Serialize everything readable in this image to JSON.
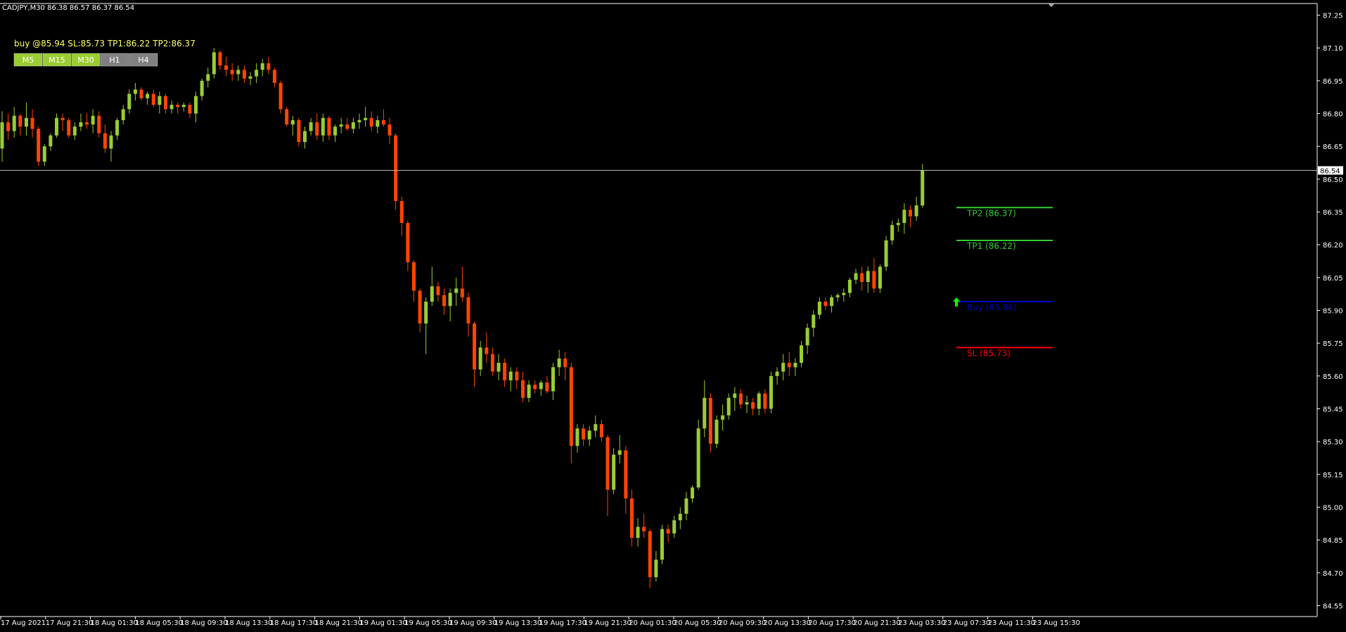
{
  "header": {
    "symbol_line": "CADJPY,M30  86.38 86.57 86.37 86.54"
  },
  "trade_info": {
    "text": "buy @85.94 SL:85.73 TP1:86.22 TP2:86.37"
  },
  "timeframe_buttons": [
    {
      "label": "M5",
      "active": true
    },
    {
      "label": "M15",
      "active": true
    },
    {
      "label": "M30",
      "active": true
    },
    {
      "label": "H1",
      "active": false
    },
    {
      "label": "H4",
      "active": false
    }
  ],
  "colors": {
    "up": "#9acd32",
    "down": "#ff4500",
    "bg": "#000000",
    "grid": "#ffffff",
    "tp": "#32cd32",
    "buy": "#0000cd",
    "sl": "#ff0000",
    "btn_active": "#9acd32",
    "btn_inactive": "#808080",
    "arrow": "#00ff00"
  },
  "chart_data": {
    "type": "candlestick",
    "symbol": "CADJPY",
    "timeframe": "M30",
    "ylim": [
      84.5,
      87.3
    ],
    "y_ticks": [
      "87.25",
      "87.10",
      "86.95",
      "86.80",
      "86.65",
      "86.50",
      "86.35",
      "86.20",
      "86.05",
      "85.90",
      "85.75",
      "85.60",
      "85.45",
      "85.30",
      "85.15",
      "85.00",
      "84.85",
      "84.70",
      "84.55"
    ],
    "current_price": "86.54",
    "x_labels": [
      "17 Aug 2021",
      "17 Aug 21:30",
      "18 Aug 01:30",
      "18 Aug 05:30",
      "18 Aug 09:30",
      "18 Aug 13:30",
      "18 Aug 17:30",
      "18 Aug 21:30",
      "19 Aug 01:30",
      "19 Aug 05:30",
      "19 Aug 09:30",
      "19 Aug 13:30",
      "19 Aug 17:30",
      "19 Aug 21:30",
      "20 Aug 01:30",
      "20 Aug 05:30",
      "20 Aug 09:30",
      "20 Aug 13:30",
      "20 Aug 17:30",
      "20 Aug 21:30",
      "23 Aug 03:30",
      "23 Aug 07:30",
      "23 Aug 11:30",
      "23 Aug 15:30"
    ],
    "candles": [
      [
        86.64,
        86.81,
        86.58,
        86.76
      ],
      [
        86.76,
        86.8,
        86.68,
        86.72
      ],
      [
        86.72,
        86.83,
        86.69,
        86.79
      ],
      [
        86.79,
        86.8,
        86.7,
        86.74
      ],
      [
        86.74,
        86.85,
        86.7,
        86.78
      ],
      [
        86.78,
        86.82,
        86.69,
        86.73
      ],
      [
        86.73,
        86.74,
        86.56,
        86.58
      ],
      [
        86.58,
        86.66,
        86.56,
        86.65
      ],
      [
        86.65,
        86.71,
        86.63,
        86.7
      ],
      [
        86.7,
        86.8,
        86.69,
        86.78
      ],
      [
        86.78,
        86.8,
        86.72,
        86.77
      ],
      [
        86.77,
        86.78,
        86.69,
        86.7
      ],
      [
        86.7,
        86.76,
        86.68,
        86.74
      ],
      [
        86.74,
        86.8,
        86.72,
        86.76
      ],
      [
        86.76,
        86.8,
        86.73,
        86.75
      ],
      [
        86.75,
        86.82,
        86.71,
        86.79
      ],
      [
        86.79,
        86.81,
        86.69,
        86.71
      ],
      [
        86.71,
        86.75,
        86.62,
        86.64
      ],
      [
        86.64,
        86.72,
        86.58,
        86.7
      ],
      [
        86.7,
        86.78,
        86.68,
        86.77
      ],
      [
        86.77,
        86.84,
        86.75,
        86.82
      ],
      [
        86.82,
        86.91,
        86.8,
        86.89
      ],
      [
        86.89,
        86.94,
        86.86,
        86.91
      ],
      [
        86.91,
        86.92,
        86.86,
        86.87
      ],
      [
        86.87,
        86.9,
        86.84,
        86.89
      ],
      [
        86.89,
        86.91,
        86.83,
        86.84
      ],
      [
        86.84,
        86.9,
        86.8,
        86.88
      ],
      [
        86.88,
        86.89,
        86.8,
        86.82
      ],
      [
        86.82,
        86.86,
        86.8,
        86.84
      ],
      [
        86.84,
        86.85,
        86.8,
        86.83
      ],
      [
        86.83,
        86.85,
        86.81,
        86.84
      ],
      [
        86.84,
        86.85,
        86.78,
        86.8
      ],
      [
        86.8,
        86.9,
        86.76,
        86.88
      ],
      [
        86.88,
        86.96,
        86.86,
        86.95
      ],
      [
        86.95,
        87.01,
        86.92,
        86.98
      ],
      [
        86.98,
        87.1,
        86.96,
        87.08
      ],
      [
        87.08,
        87.09,
        87.0,
        87.02
      ],
      [
        87.02,
        87.06,
        86.97,
        87.0
      ],
      [
        87.0,
        87.03,
        86.95,
        86.98
      ],
      [
        86.98,
        87.02,
        86.95,
        87.0
      ],
      [
        87.0,
        87.02,
        86.94,
        86.96
      ],
      [
        86.96,
        86.99,
        86.93,
        86.97
      ],
      [
        86.97,
        87.03,
        86.94,
        87.0
      ],
      [
        87.0,
        87.05,
        86.97,
        87.03
      ],
      [
        87.03,
        87.06,
        86.98,
        87.0
      ],
      [
        87.0,
        87.01,
        86.92,
        86.94
      ],
      [
        86.94,
        86.95,
        86.8,
        86.82
      ],
      [
        86.82,
        86.83,
        86.74,
        86.75
      ],
      [
        86.75,
        86.79,
        86.7,
        86.77
      ],
      [
        86.77,
        86.78,
        86.65,
        86.67
      ],
      [
        86.67,
        86.74,
        86.64,
        86.72
      ],
      [
        86.72,
        86.78,
        86.7,
        86.76
      ],
      [
        86.76,
        86.8,
        86.68,
        86.7
      ],
      [
        86.7,
        86.8,
        86.67,
        86.78
      ],
      [
        86.78,
        86.79,
        86.68,
        86.7
      ],
      [
        86.7,
        86.75,
        86.67,
        86.74
      ],
      [
        86.74,
        86.78,
        86.71,
        86.75
      ],
      [
        86.75,
        86.78,
        86.72,
        86.73
      ],
      [
        86.73,
        86.78,
        86.71,
        86.76
      ],
      [
        86.76,
        86.8,
        86.73,
        86.77
      ],
      [
        86.77,
        86.83,
        86.74,
        86.78
      ],
      [
        86.78,
        86.81,
        86.72,
        86.74
      ],
      [
        86.74,
        86.79,
        86.71,
        86.77
      ],
      [
        86.77,
        86.82,
        86.74,
        86.75
      ],
      [
        86.75,
        86.78,
        86.66,
        86.7
      ],
      [
        86.7,
        86.71,
        86.36,
        86.4
      ],
      [
        86.4,
        86.42,
        86.24,
        86.3
      ],
      [
        86.3,
        86.31,
        86.08,
        86.12
      ],
      [
        86.12,
        86.13,
        85.94,
        85.99
      ],
      [
        85.99,
        86.0,
        85.8,
        85.84
      ],
      [
        85.84,
        85.96,
        85.7,
        85.94
      ],
      [
        85.94,
        86.1,
        85.92,
        86.01
      ],
      [
        86.01,
        86.03,
        85.94,
        85.97
      ],
      [
        85.97,
        86.0,
        85.88,
        85.92
      ],
      [
        85.92,
        86.0,
        85.85,
        85.98
      ],
      [
        85.98,
        86.05,
        85.92,
        86.0
      ],
      [
        86.0,
        86.1,
        85.94,
        85.96
      ],
      [
        85.96,
        85.98,
        85.78,
        85.84
      ],
      [
        85.84,
        85.85,
        85.55,
        85.63
      ],
      [
        85.63,
        85.76,
        85.6,
        85.73
      ],
      [
        85.73,
        85.8,
        85.66,
        85.7
      ],
      [
        85.7,
        85.73,
        85.6,
        85.62
      ],
      [
        85.62,
        85.7,
        85.58,
        85.66
      ],
      [
        85.66,
        85.68,
        85.55,
        85.58
      ],
      [
        85.58,
        85.64,
        85.53,
        85.62
      ],
      [
        85.62,
        85.64,
        85.54,
        85.58
      ],
      [
        85.58,
        85.62,
        85.48,
        85.5
      ],
      [
        85.5,
        85.58,
        85.48,
        85.56
      ],
      [
        85.56,
        85.58,
        85.52,
        85.54
      ],
      [
        85.54,
        85.58,
        85.51,
        85.57
      ],
      [
        85.57,
        85.6,
        85.52,
        85.53
      ],
      [
        85.53,
        85.66,
        85.49,
        85.64
      ],
      [
        85.64,
        85.72,
        85.6,
        85.68
      ],
      [
        85.68,
        85.71,
        85.58,
        85.64
      ],
      [
        85.64,
        85.66,
        85.2,
        85.28
      ],
      [
        85.28,
        85.38,
        85.25,
        85.36
      ],
      [
        85.36,
        85.38,
        85.28,
        85.31
      ],
      [
        85.31,
        85.37,
        85.28,
        85.35
      ],
      [
        85.35,
        85.42,
        85.32,
        85.38
      ],
      [
        85.38,
        85.4,
        85.3,
        85.32
      ],
      [
        85.32,
        85.33,
        84.96,
        85.08
      ],
      [
        85.08,
        85.27,
        85.06,
        85.24
      ],
      [
        85.24,
        85.33,
        85.2,
        85.26
      ],
      [
        85.26,
        85.28,
        84.97,
        85.04
      ],
      [
        85.04,
        85.08,
        84.82,
        84.86
      ],
      [
        84.86,
        84.95,
        84.82,
        84.91
      ],
      [
        84.91,
        84.97,
        84.86,
        84.89
      ],
      [
        84.89,
        84.9,
        84.63,
        84.68
      ],
      [
        84.68,
        84.8,
        84.66,
        84.76
      ],
      [
        84.76,
        84.92,
        84.74,
        84.9
      ],
      [
        84.9,
        84.92,
        84.84,
        84.88
      ],
      [
        84.88,
        84.96,
        84.86,
        84.94
      ],
      [
        84.94,
        85.0,
        84.9,
        84.97
      ],
      [
        84.97,
        85.07,
        84.94,
        85.04
      ],
      [
        85.04,
        85.1,
        85.02,
        85.09
      ],
      [
        85.09,
        85.4,
        85.08,
        85.36
      ],
      [
        85.36,
        85.58,
        85.32,
        85.5
      ],
      [
        85.5,
        85.52,
        85.25,
        85.29
      ],
      [
        85.29,
        85.42,
        85.27,
        85.4
      ],
      [
        85.4,
        85.47,
        85.35,
        85.42
      ],
      [
        85.42,
        85.52,
        85.4,
        85.5
      ],
      [
        85.5,
        85.55,
        85.44,
        85.52
      ],
      [
        85.52,
        85.54,
        85.45,
        85.47
      ],
      [
        85.47,
        85.51,
        85.43,
        85.48
      ],
      [
        85.48,
        85.5,
        85.42,
        85.45
      ],
      [
        85.45,
        85.53,
        85.42,
        85.52
      ],
      [
        85.52,
        85.54,
        85.43,
        85.45
      ],
      [
        85.45,
        85.62,
        85.43,
        85.6
      ],
      [
        85.6,
        85.64,
        85.56,
        85.62
      ],
      [
        85.62,
        85.7,
        85.58,
        85.66
      ],
      [
        85.66,
        85.71,
        85.6,
        85.64
      ],
      [
        85.64,
        85.68,
        85.6,
        85.66
      ],
      [
        85.66,
        85.76,
        85.64,
        85.74
      ],
      [
        85.74,
        85.84,
        85.7,
        85.82
      ],
      [
        85.82,
        85.9,
        85.78,
        85.88
      ],
      [
        85.88,
        85.96,
        85.86,
        85.94
      ],
      [
        85.94,
        85.96,
        85.9,
        85.92
      ],
      [
        85.92,
        85.97,
        85.89,
        85.96
      ],
      [
        85.96,
        85.98,
        85.94,
        85.97
      ],
      [
        85.97,
        86.0,
        85.94,
        85.98
      ],
      [
        85.98,
        86.05,
        85.96,
        86.04
      ],
      [
        86.04,
        86.09,
        86.02,
        86.07
      ],
      [
        86.07,
        86.1,
        85.99,
        86.03
      ],
      [
        86.03,
        86.1,
        85.98,
        86.08
      ],
      [
        86.08,
        86.14,
        85.98,
        86.0
      ],
      [
        86.0,
        86.11,
        85.98,
        86.1
      ],
      [
        86.1,
        86.24,
        86.08,
        86.22
      ],
      [
        86.22,
        86.31,
        86.2,
        86.29
      ],
      [
        86.29,
        86.32,
        86.26,
        86.3
      ],
      [
        86.3,
        86.39,
        86.25,
        86.36
      ],
      [
        86.36,
        86.38,
        86.28,
        86.33
      ],
      [
        86.33,
        86.42,
        86.31,
        86.38
      ],
      [
        86.38,
        86.57,
        86.37,
        86.54
      ]
    ],
    "levels": [
      {
        "label": "TP2 (86.37)",
        "price": 86.37,
        "color_key": "tp"
      },
      {
        "label": "TP1 (86.22)",
        "price": 86.22,
        "color_key": "tp"
      },
      {
        "label": "Buy (85.94)",
        "price": 85.94,
        "color_key": "buy"
      },
      {
        "label": "SL (85.73)",
        "price": 85.73,
        "color_key": "sl"
      }
    ],
    "entry_marker": {
      "price": 85.94,
      "icon": "up-arrow-icon"
    }
  }
}
